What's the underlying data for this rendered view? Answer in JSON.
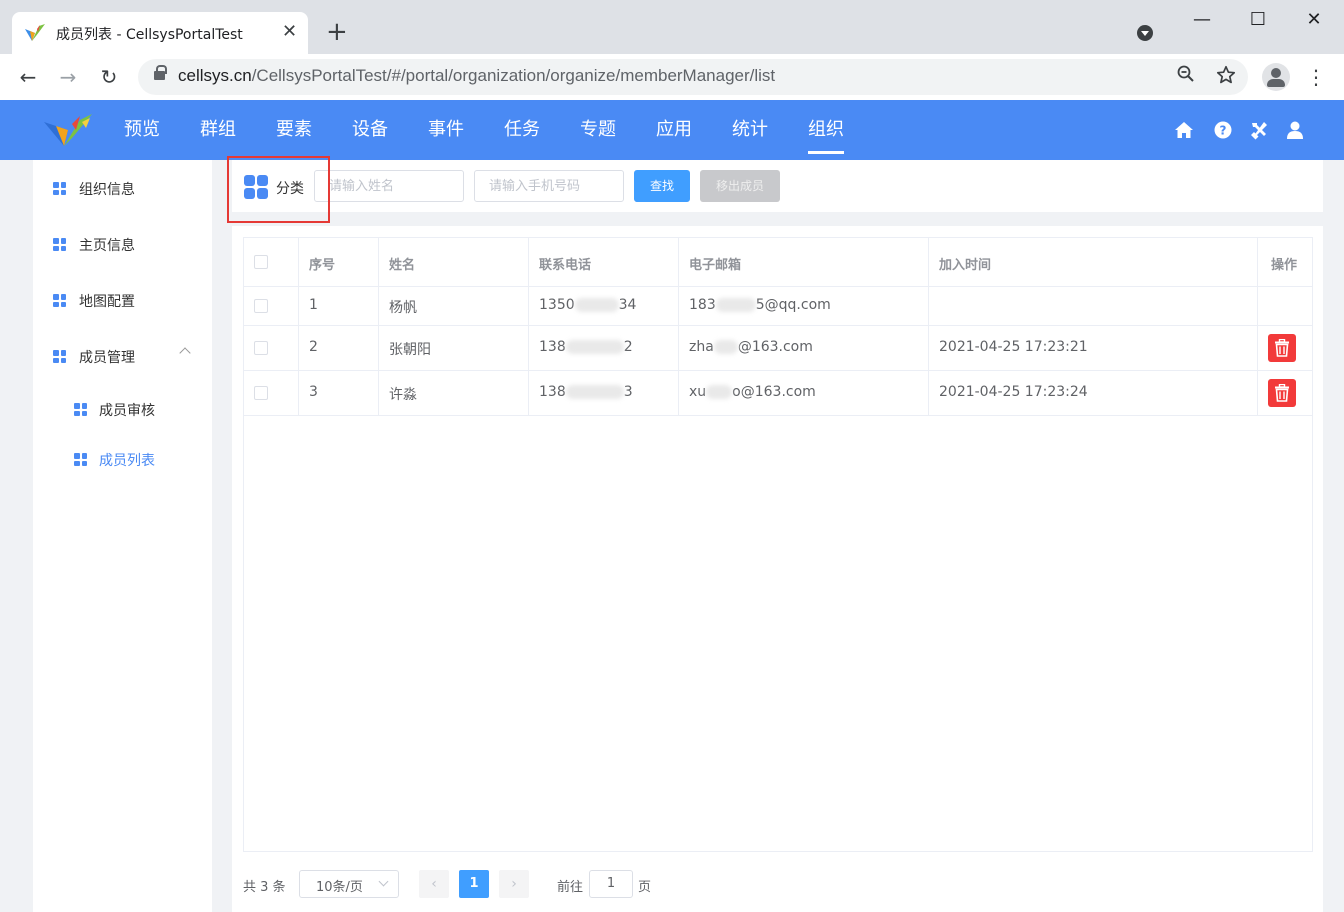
{
  "browser": {
    "tab_title": "成员列表 - CellsysPortalTest",
    "tab_close": "✕",
    "new_tab": "+",
    "url_host": "cellsys.cn",
    "url_path": "/CellsysPortalTest/#/portal/organization/organize/memberManager/list",
    "nav": {
      "back": "←",
      "forward": "→",
      "reload": "↻"
    },
    "window": {
      "minimize": "—",
      "maximize": "☐",
      "close": "✕"
    },
    "omnibox_icons": {
      "zoom": "zoom-out-icon",
      "bookmark": "star-icon"
    },
    "kebab": "⋮"
  },
  "header": {
    "nav_items": [
      {
        "label": "预览"
      },
      {
        "label": "群组"
      },
      {
        "label": "要素"
      },
      {
        "label": "设备"
      },
      {
        "label": "事件"
      },
      {
        "label": "任务"
      },
      {
        "label": "专题"
      },
      {
        "label": "应用"
      },
      {
        "label": "统计"
      },
      {
        "label": "组织",
        "active": true
      }
    ],
    "icons": [
      "home-icon",
      "help-icon",
      "tools-icon",
      "user-icon"
    ],
    "color": "#4a8af4"
  },
  "sidebar": {
    "items": [
      {
        "label": "组织信息"
      },
      {
        "label": "主页信息"
      },
      {
        "label": "地图配置"
      },
      {
        "label": "成员管理",
        "expanded": true
      },
      {
        "label": "成员审核",
        "sub": true
      },
      {
        "label": "成员列表",
        "sub": true,
        "active": true
      }
    ]
  },
  "search": {
    "category_label": "分类",
    "name_placeholder": "请输入姓名",
    "phone_placeholder": "请输入手机号码",
    "search_button": "查找",
    "remove_button": "移出成员"
  },
  "table": {
    "columns": [
      "序号",
      "姓名",
      "联系电话",
      "电子邮箱",
      "加入时间",
      "操作"
    ],
    "rows": [
      {
        "index": "1",
        "name": "杨帆",
        "phone_a": "1350",
        "phone_b": "34",
        "email_a": "183",
        "email_b": "5@qq.com",
        "joined": "",
        "deletable": false
      },
      {
        "index": "2",
        "name": "张朝阳",
        "phone_a": "138",
        "phone_b": "2",
        "email_a": "zha",
        "email_b": "@163.com",
        "joined": "2021-04-25 17:23:21",
        "deletable": true
      },
      {
        "index": "3",
        "name": "许淼",
        "phone_a": "138",
        "phone_b": "3",
        "email_a": "xu",
        "email_b": "o@163.com",
        "joined": "2021-04-25 17:23:24",
        "deletable": true
      }
    ]
  },
  "pagination": {
    "total": "共 3 条",
    "page_size": "10条/页",
    "prev": "‹",
    "next": "›",
    "current_page": "1",
    "goto_label": "前往",
    "goto_value": "1",
    "page_suffix": "页"
  }
}
